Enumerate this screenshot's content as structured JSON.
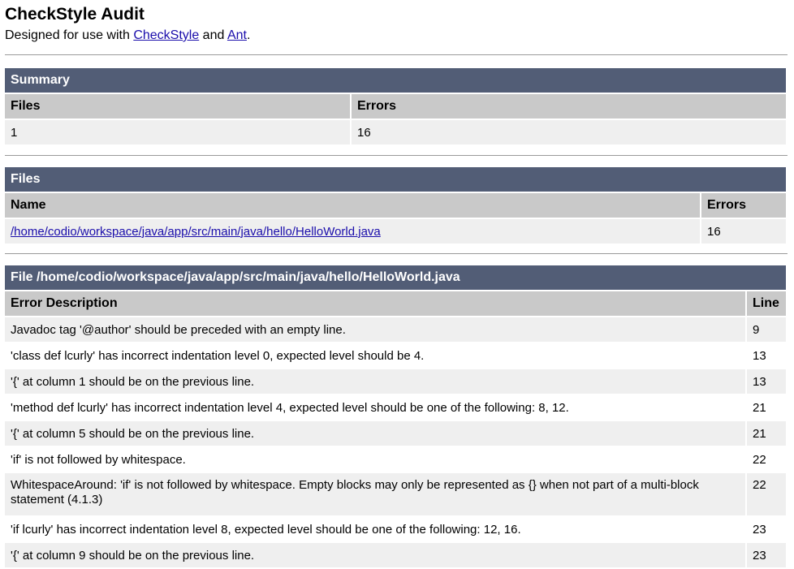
{
  "header": {
    "title": "CheckStyle Audit",
    "subtitle_prefix": "Designed for use with ",
    "link_checkstyle": "CheckStyle",
    "subtitle_and": " and ",
    "link_ant": "Ant",
    "subtitle_suffix": "."
  },
  "summary": {
    "caption": "Summary",
    "columns": [
      "Files",
      "Errors"
    ],
    "files": "1",
    "errors": "16"
  },
  "files": {
    "caption": "Files",
    "columns": [
      "Name",
      "Errors"
    ],
    "rows": [
      {
        "name": "/home/codio/workspace/java/app/src/main/java/hello/HelloWorld.java",
        "errors": "16"
      }
    ]
  },
  "file_detail": {
    "caption": "File /home/codio/workspace/java/app/src/main/java/hello/HelloWorld.java",
    "columns": [
      "Error Description",
      "Line"
    ],
    "rows": [
      {
        "desc": "Javadoc tag '@author' should be preceded with an empty line.",
        "line": "9"
      },
      {
        "desc": "'class def lcurly' has incorrect indentation level 0, expected level should be 4.",
        "line": "13"
      },
      {
        "desc": "'{' at column 1 should be on the previous line.",
        "line": "13"
      },
      {
        "desc": "'method def lcurly' has incorrect indentation level 4, expected level should be one of the following: 8, 12.",
        "line": "21"
      },
      {
        "desc": "'{' at column 5 should be on the previous line.",
        "line": "21"
      },
      {
        "desc": "'if' is not followed by whitespace.",
        "line": "22"
      },
      {
        "desc": "WhitespaceAround: 'if' is not followed by whitespace. Empty blocks may only be represented as {} when not part of a multi-block statement (4.1.3)",
        "line": "22"
      },
      {
        "desc": "'if lcurly' has incorrect indentation level 8, expected level should be one of the following: 12, 16.",
        "line": "23"
      },
      {
        "desc": "'{' at column 9 should be on the previous line.",
        "line": "23"
      }
    ]
  },
  "colors": {
    "caption_bg": "#525d76",
    "column_header_bg": "#c9c9c9",
    "row_alt_bg": "#efefef",
    "link": "#1a0dab"
  }
}
